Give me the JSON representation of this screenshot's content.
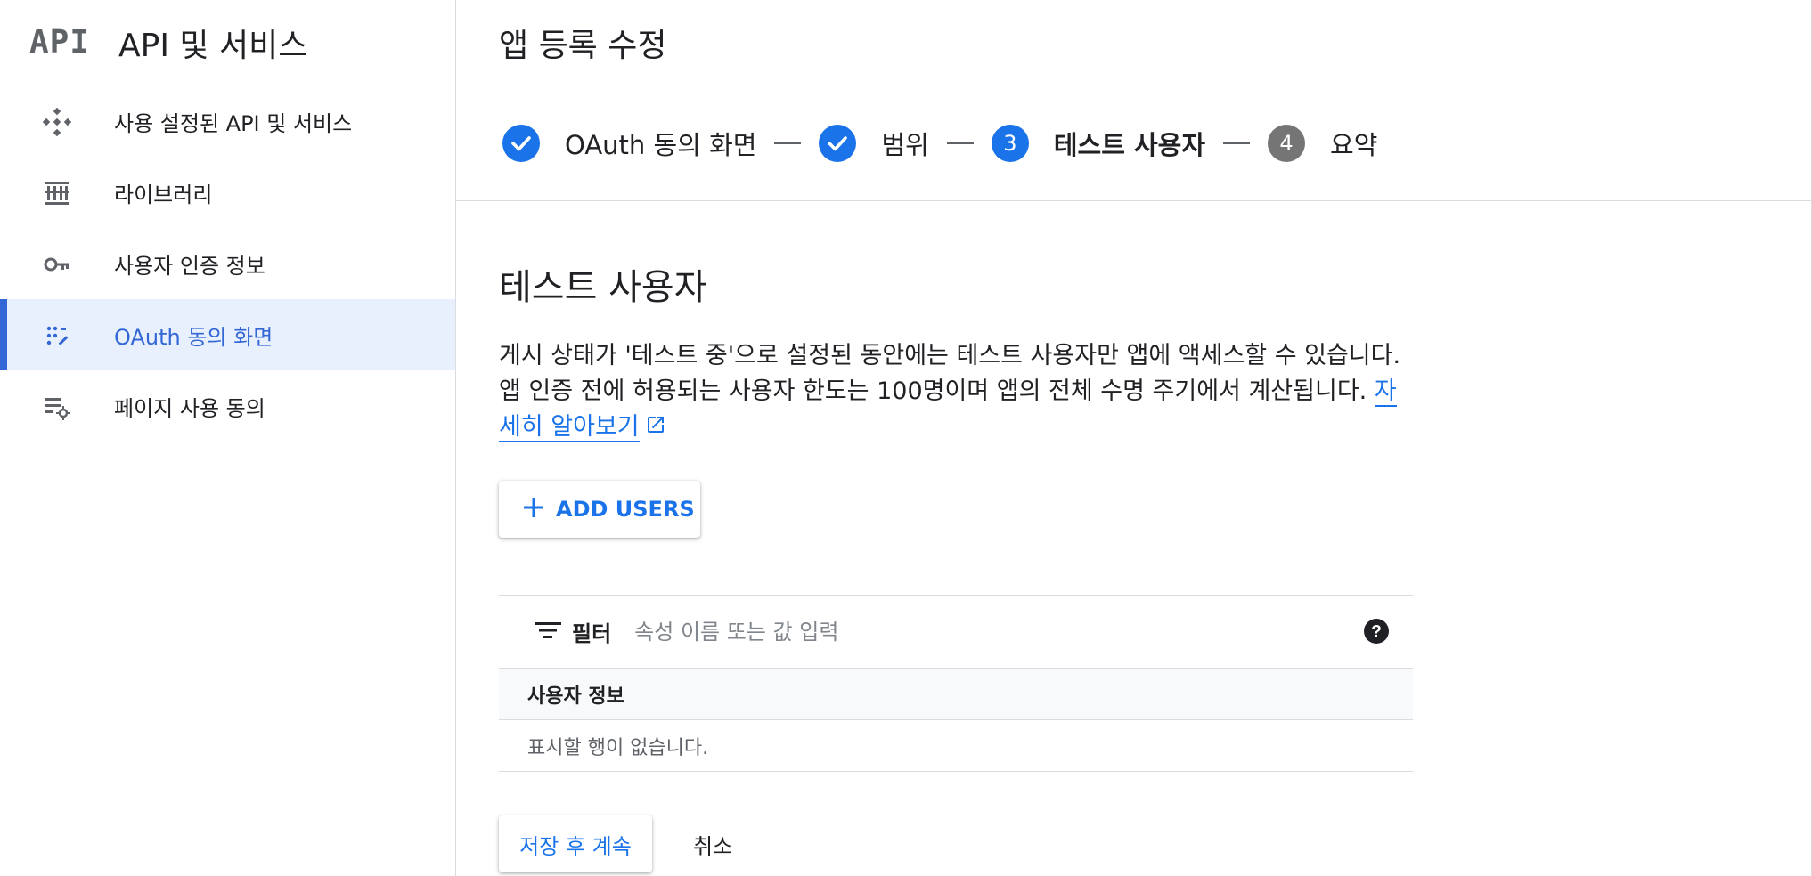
{
  "brand": {
    "logo": "API",
    "title": "API 및 서비스"
  },
  "sidebar": {
    "items": [
      {
        "label": "사용 설정된 API 및 서비스",
        "icon": "diamond-grid-icon",
        "active": false
      },
      {
        "label": "라이브러리",
        "icon": "library-icon",
        "active": false
      },
      {
        "label": "사용자 인증 정보",
        "icon": "key-icon",
        "active": false
      },
      {
        "label": "OAuth 동의 화면",
        "icon": "oauth-consent-icon",
        "active": true
      },
      {
        "label": "페이지 사용 동의",
        "icon": "page-settings-icon",
        "active": false
      }
    ]
  },
  "header": {
    "title": "앱 등록 수정"
  },
  "stepper": {
    "steps": [
      {
        "label": "OAuth 동의 화면",
        "state": "done",
        "marker": "check-icon"
      },
      {
        "label": "범위",
        "state": "done",
        "marker": "check-icon"
      },
      {
        "label": "테스트 사용자",
        "state": "current",
        "number": "3"
      },
      {
        "label": "요약",
        "state": "pending",
        "number": "4"
      }
    ]
  },
  "section": {
    "title": "테스트 사용자",
    "description": "게시 상태가 '테스트 중'으로 설정된 동안에는 테스트 사용자만 앱에 액세스할 수 있습니다. 앱 인증 전에 허용되는 사용자 한도는 100명이며 앱의 전체 수명 주기에서 계산됩니다.",
    "learn_more": "자세히 알아보기"
  },
  "add_users": {
    "label": "ADD USERS"
  },
  "table": {
    "filter_label": "필터",
    "filter_placeholder": "속성 이름 또는 값 입력",
    "column_header": "사용자 정보",
    "empty_message": "표시할 행이 없습니다."
  },
  "actions": {
    "save_label": "저장 후 계속",
    "cancel_label": "취소"
  },
  "colors": {
    "accent": "#1a73e8",
    "active_nav_bg": "#e8f0fe",
    "active_nav_bar": "#3367d6",
    "pending_step": "#757575"
  }
}
